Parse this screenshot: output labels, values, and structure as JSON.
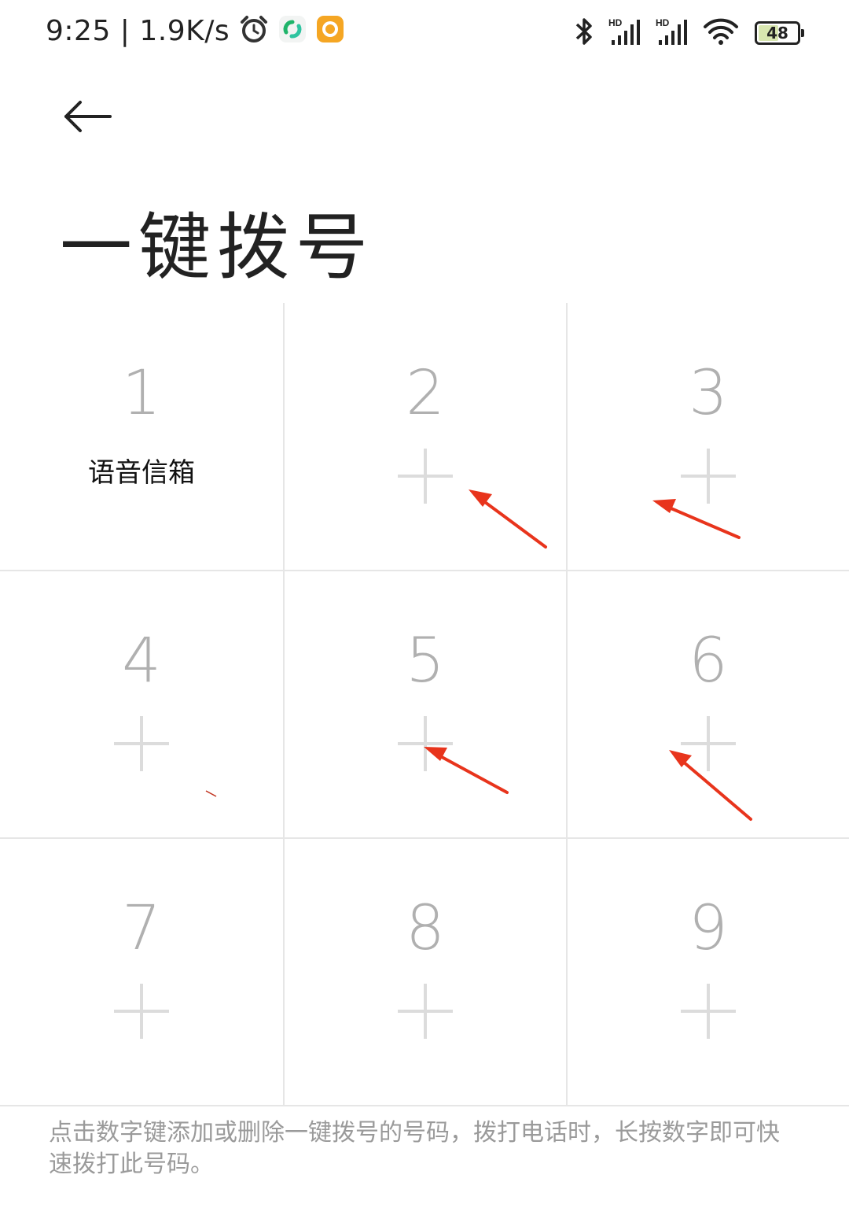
{
  "status_bar": {
    "time_speed": "9:25 | 1.9K/s",
    "battery_level": "48",
    "battery_fraction": 0.48,
    "icons": [
      "alarm-icon",
      "app-green-icon",
      "app-orange-icon",
      "bluetooth-icon",
      "signal-hd-1-icon",
      "signal-hd-2-icon",
      "wifi-icon",
      "battery-icon"
    ]
  },
  "header": {
    "back_icon": "arrow-left-icon",
    "title": "一键拨号"
  },
  "keys": [
    {
      "digit": "1",
      "label": "语音信箱"
    },
    {
      "digit": "2"
    },
    {
      "digit": "3"
    },
    {
      "digit": "4"
    },
    {
      "digit": "5"
    },
    {
      "digit": "6"
    },
    {
      "digit": "7"
    },
    {
      "digit": "8"
    },
    {
      "digit": "9"
    }
  ],
  "add_icon": "plus-icon",
  "hint": "点击数字键添加或删除一键拨号的号码，拨打电话时，长按数字即可快速拨打此号码。",
  "colors": {
    "background": "#ffffff",
    "digit": "#b0b0b0",
    "plus": "#dcdcdc",
    "hint": "#9a9a9a",
    "annotation_arrow": "#e8341c"
  }
}
